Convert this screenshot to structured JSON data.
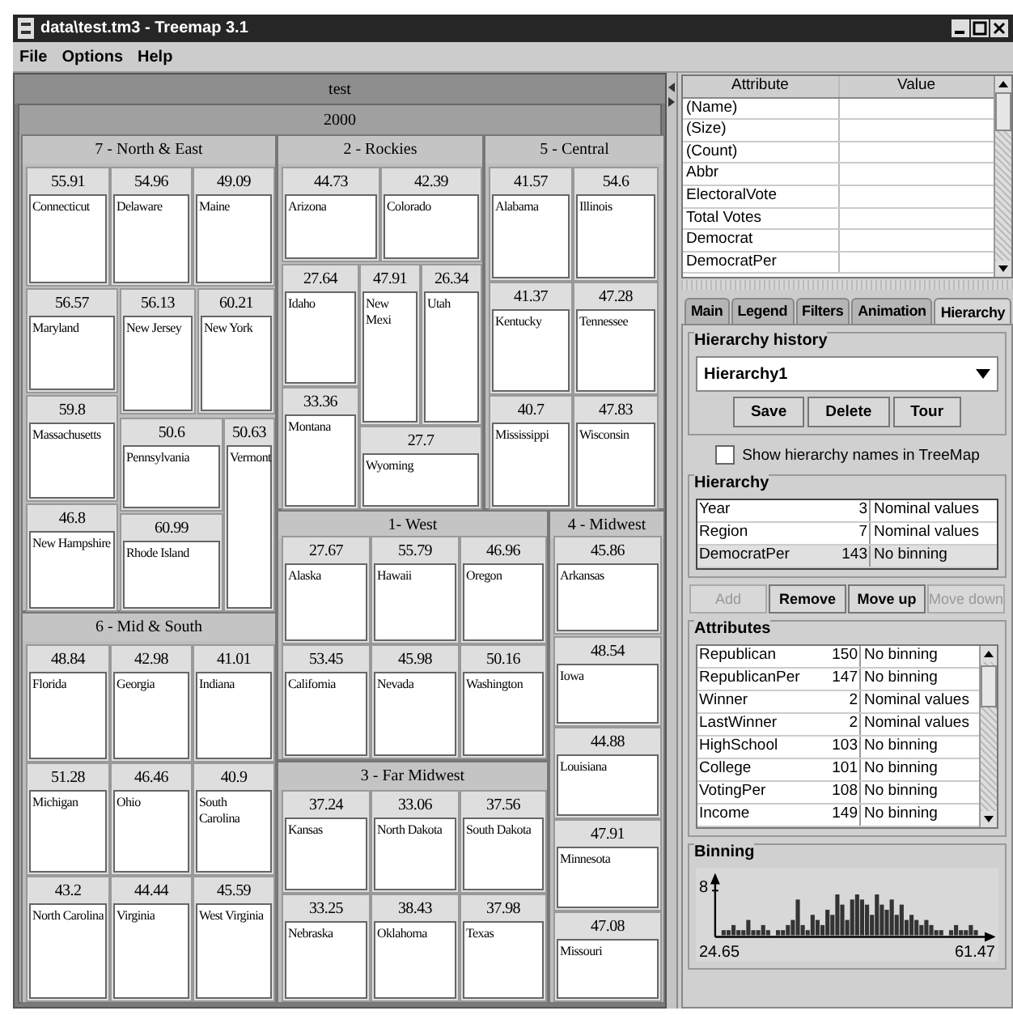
{
  "window": {
    "title": "data\\test.tm3 - Treemap 3.1"
  },
  "menu": [
    "File",
    "Options",
    "Help"
  ],
  "treemap": {
    "root": "test",
    "year": "2000",
    "regions": [
      {
        "label": "7 - North & East",
        "states": [
          {
            "value": "55.91",
            "name": "Connecticut"
          },
          {
            "value": "54.96",
            "name": "Delaware"
          },
          {
            "value": "49.09",
            "name": "Maine"
          },
          {
            "value": "56.57",
            "name": "Maryland"
          },
          {
            "value": "56.13",
            "name": "New Jersey"
          },
          {
            "value": "60.21",
            "name": "New York"
          },
          {
            "value": "59.8",
            "name": "Massachusetts"
          },
          {
            "value": "50.6",
            "name": "Pennsylvania"
          },
          {
            "value": "50.63",
            "name": "Vermont"
          },
          {
            "value": "46.8",
            "name": "New Hampshire"
          },
          {
            "value": "60.99",
            "name": "Rhode Island"
          }
        ]
      },
      {
        "label": "2 - Rockies",
        "states": [
          {
            "value": "44.73",
            "name": "Arizona"
          },
          {
            "value": "42.39",
            "name": "Colorado"
          },
          {
            "value": "27.64",
            "name": "Idaho"
          },
          {
            "value": "47.91",
            "name": "New Mexi"
          },
          {
            "value": "26.34",
            "name": "Utah"
          },
          {
            "value": "33.36",
            "name": "Montana"
          },
          {
            "value": "27.7",
            "name": "Wyoming"
          }
        ]
      },
      {
        "label": "5 - Central",
        "states": [
          {
            "value": "41.57",
            "name": "Alabama"
          },
          {
            "value": "54.6",
            "name": "Illinois"
          },
          {
            "value": "41.37",
            "name": "Kentucky"
          },
          {
            "value": "47.28",
            "name": "Tennessee"
          },
          {
            "value": "40.7",
            "name": "Mississippi"
          },
          {
            "value": "47.83",
            "name": "Wisconsin"
          }
        ]
      },
      {
        "label": "1- West",
        "states": [
          {
            "value": "27.67",
            "name": "Alaska"
          },
          {
            "value": "55.79",
            "name": "Hawaii"
          },
          {
            "value": "46.96",
            "name": "Oregon"
          },
          {
            "value": "53.45",
            "name": "California"
          },
          {
            "value": "45.98",
            "name": "Nevada"
          },
          {
            "value": "50.16",
            "name": "Washington"
          }
        ]
      },
      {
        "label": "4 - Midwest",
        "states": [
          {
            "value": "45.86",
            "name": "Arkansas"
          },
          {
            "value": "48.54",
            "name": "Iowa"
          },
          {
            "value": "44.88",
            "name": "Louisiana"
          },
          {
            "value": "47.91",
            "name": "Minnesota"
          },
          {
            "value": "47.08",
            "name": "Missouri"
          }
        ]
      },
      {
        "label": "6 - Mid & South",
        "states": [
          {
            "value": "48.84",
            "name": "Florida"
          },
          {
            "value": "42.98",
            "name": "Georgia"
          },
          {
            "value": "41.01",
            "name": "Indiana"
          },
          {
            "value": "51.28",
            "name": "Michigan"
          },
          {
            "value": "46.46",
            "name": "Ohio"
          },
          {
            "value": "40.9",
            "name": "South Carolina"
          },
          {
            "value": "43.2",
            "name": "North Carolina"
          },
          {
            "value": "44.44",
            "name": "Virginia"
          },
          {
            "value": "45.59",
            "name": "West Virginia"
          }
        ]
      },
      {
        "label": "3 - Far Midwest",
        "states": [
          {
            "value": "37.24",
            "name": "Kansas"
          },
          {
            "value": "33.06",
            "name": "North Dakota"
          },
          {
            "value": "37.56",
            "name": "South Dakota"
          },
          {
            "value": "33.25",
            "name": "Nebraska"
          },
          {
            "value": "38.43",
            "name": "Oklahoma"
          },
          {
            "value": "37.98",
            "name": "Texas"
          }
        ]
      }
    ]
  },
  "properties": {
    "columns": [
      "Attribute",
      "Value"
    ],
    "rows": [
      "(Name)",
      "(Size)",
      "(Count)",
      "Abbr",
      "ElectoralVote",
      "Total Votes",
      "Democrat",
      "DemocratPer"
    ]
  },
  "tabs": [
    {
      "label": "Main",
      "selected": false
    },
    {
      "label": "Legend",
      "selected": false
    },
    {
      "label": "Filters",
      "selected": false
    },
    {
      "label": "Animation",
      "selected": false
    },
    {
      "label": "Hierarchy",
      "selected": true
    }
  ],
  "hierarchy_history": {
    "title": "Hierarchy history",
    "value": "Hierarchy1",
    "buttons": [
      "Save",
      "Delete",
      "Tour"
    ]
  },
  "show_names": {
    "label": "Show hierarchy names in TreeMap",
    "checked": false
  },
  "hierarchy": {
    "title": "Hierarchy",
    "rows": [
      {
        "name": "Year",
        "count": "3",
        "binning": "Nominal values",
        "selected": false
      },
      {
        "name": "Region",
        "count": "7",
        "binning": "Nominal values",
        "selected": false
      },
      {
        "name": "DemocratPer",
        "count": "143",
        "binning": "No binning",
        "selected": true
      }
    ]
  },
  "hierarchy_buttons": [
    {
      "label": "Add",
      "disabled": true
    },
    {
      "label": "Remove",
      "disabled": false
    },
    {
      "label": "Move up",
      "disabled": false
    },
    {
      "label": "Move down",
      "disabled": true
    }
  ],
  "attributes": {
    "title": "Attributes",
    "rows": [
      {
        "name": "Republican",
        "count": "150",
        "binning": "No binning"
      },
      {
        "name": "RepublicanPer",
        "count": "147",
        "binning": "No binning"
      },
      {
        "name": "Winner",
        "count": "2",
        "binning": "Nominal values"
      },
      {
        "name": "LastWinner",
        "count": "2",
        "binning": "Nominal values"
      },
      {
        "name": "HighSchool",
        "count": "103",
        "binning": "No binning"
      },
      {
        "name": "College",
        "count": "101",
        "binning": "No binning"
      },
      {
        "name": "VotingPer",
        "count": "108",
        "binning": "No binning"
      },
      {
        "name": "Income",
        "count": "149",
        "binning": "No binning"
      }
    ]
  },
  "binning": {
    "title": "Binning",
    "y_tick": "8",
    "min": "24.65",
    "max": "61.47"
  }
}
